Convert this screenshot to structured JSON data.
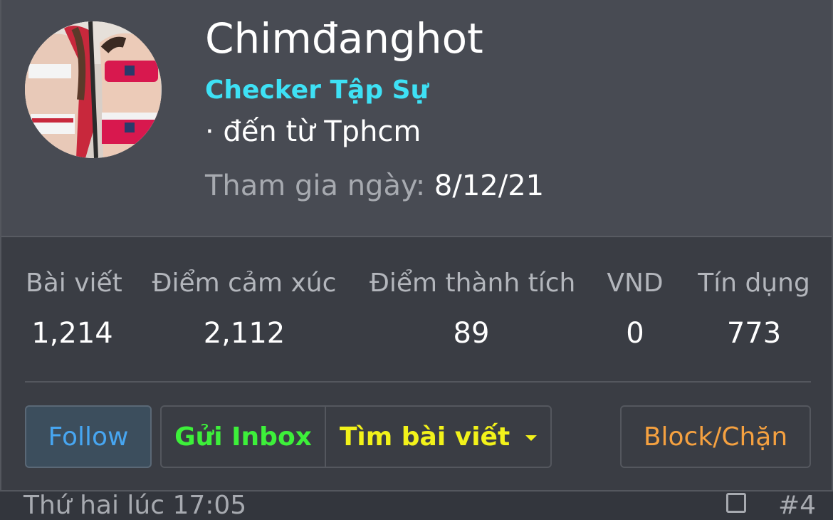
{
  "profile": {
    "username": "Chimđanghot",
    "user_title": "Checker Tập Sự",
    "location": "· đến từ Tphcm",
    "joined_label": "Tham gia ngày:",
    "joined_value": "8/12/21",
    "title_color": "#3ee1f5",
    "avatar_icon": "avatar-photo"
  },
  "stats": [
    {
      "label": "Bài viết",
      "value": "1,214"
    },
    {
      "label": "Điểm cảm xúc",
      "value": "2,112"
    },
    {
      "label": "Điểm thành tích",
      "value": "89"
    },
    {
      "label": "VND",
      "value": "0"
    },
    {
      "label": "Tín dụng",
      "value": "773"
    }
  ],
  "actions": {
    "follow": "Follow",
    "inbox": "Gửi Inbox",
    "find_posts": "Tìm bài viết",
    "block": "Block/Chặn",
    "follow_color": "#47a6f1",
    "inbox_color": "#3df03a",
    "find_color": "#f2f21a",
    "block_color": "#f5a140"
  },
  "next_post": {
    "time": "Thứ hai lúc 17:05",
    "number": "#4"
  }
}
